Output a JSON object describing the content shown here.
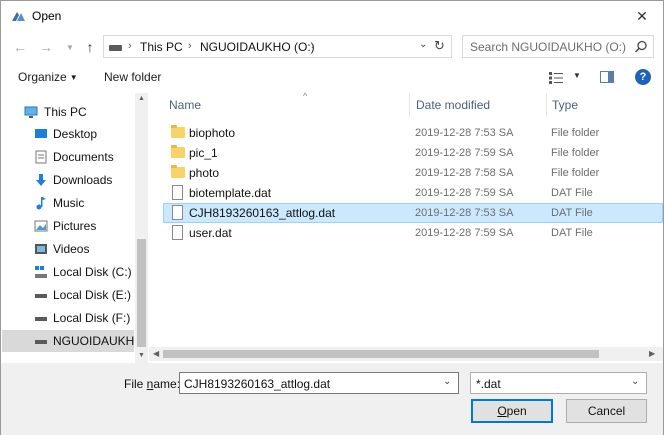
{
  "window": {
    "title": "Open"
  },
  "address": {
    "parts": [
      "This PC",
      "NGUOIDAUKHO (O:)"
    ],
    "search_placeholder": "Search NGUOIDAUKHO (O:)"
  },
  "toolbar": {
    "organize_label": "Organize",
    "new_folder_label": "New folder"
  },
  "nav": {
    "items": [
      {
        "label": "This PC",
        "icon": "computer-icon"
      },
      {
        "label": "Desktop",
        "icon": "desktop-icon"
      },
      {
        "label": "Documents",
        "icon": "documents-icon"
      },
      {
        "label": "Downloads",
        "icon": "download-arrow-icon"
      },
      {
        "label": "Music",
        "icon": "music-note-icon"
      },
      {
        "label": "Pictures",
        "icon": "pictures-icon"
      },
      {
        "label": "Videos",
        "icon": "videos-icon"
      },
      {
        "label": "Local Disk (C:)",
        "icon": "drive-windows-icon"
      },
      {
        "label": "Local Disk (E:)",
        "icon": "drive-icon"
      },
      {
        "label": "Local Disk (F:)",
        "icon": "drive-icon"
      },
      {
        "label": "NGUOIDAUKHO",
        "icon": "drive-icon"
      }
    ]
  },
  "files": {
    "columns": {
      "name": "Name",
      "date": "Date modified",
      "type": "Type"
    },
    "rows": [
      {
        "name": "biophoto",
        "date": "2019-12-28 7:53 SA",
        "type": "File folder",
        "kind": "folder"
      },
      {
        "name": "pic_1",
        "date": "2019-12-28 7:59 SA",
        "type": "File folder",
        "kind": "folder"
      },
      {
        "name": "photo",
        "date": "2019-12-28 7:58 SA",
        "type": "File folder",
        "kind": "folder"
      },
      {
        "name": "biotemplate.dat",
        "date": "2019-12-28 7:59 SA",
        "type": "DAT File",
        "kind": "file"
      },
      {
        "name": "CJH8193260163_attlog.dat",
        "date": "2019-12-28 7:53 SA",
        "type": "DAT File",
        "kind": "file"
      },
      {
        "name": "user.dat",
        "date": "2019-12-28 7:59 SA",
        "type": "DAT File",
        "kind": "file"
      }
    ]
  },
  "bottom": {
    "file_name_label_prefix": "File ",
    "file_name_label_key": "n",
    "file_name_label_suffix": "ame:",
    "file_name_value": "CJH8193260163_attlog.dat",
    "filter_value": "*.dat",
    "open_key": "O",
    "open_rest": "pen",
    "cancel_label": "Cancel"
  },
  "colors": {
    "selection": "#cce8ff",
    "selection_border": "#99d1ff",
    "accent": "#0078d7",
    "folder": "#f8d36b"
  }
}
